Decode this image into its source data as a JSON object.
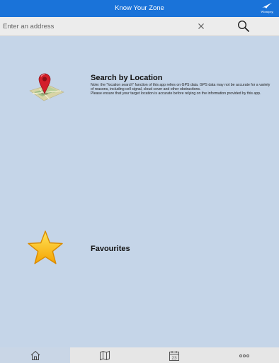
{
  "app": {
    "title": "Know Your Zone",
    "logo_text": "Winnipeg"
  },
  "search": {
    "placeholder": "Enter an address",
    "value": ""
  },
  "menu": {
    "location": {
      "title": "Search by Location",
      "note_line1": "Note: the \"location search\" function of this app relies on GPS data. GPS data may not be accurate for a variety of reasons, including cell signal, cloud cover and other obstructions.",
      "note_line2": "Please ensure that your target location is accurate before relying on the information provided by this app.",
      "icon": "map-pin-icon"
    },
    "favourites": {
      "title": "Favourites",
      "icon": "star-icon"
    }
  },
  "tabs": [
    {
      "icon": "home-icon",
      "active": true
    },
    {
      "icon": "map-icon",
      "active": false
    },
    {
      "icon": "calendar-icon",
      "label": "23",
      "active": false
    },
    {
      "icon": "more-icon",
      "active": false
    }
  ],
  "colors": {
    "header": "#1a73d9",
    "background": "#c5d5e8",
    "active_tab": "#c9d6e6"
  }
}
